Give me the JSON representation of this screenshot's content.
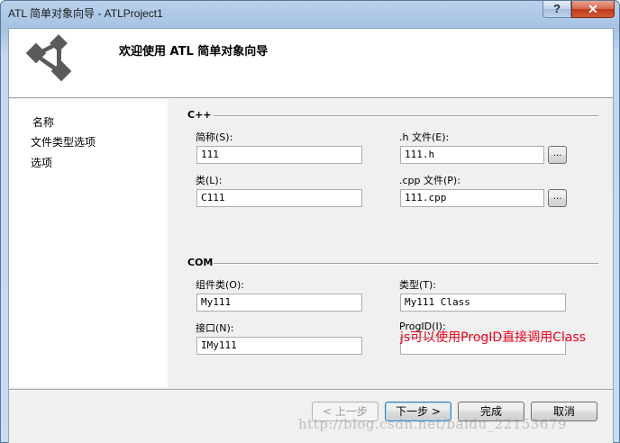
{
  "window": {
    "title": "ATL 简单对象向导 - ATLProject1",
    "help_label": "?",
    "close_label": "✕"
  },
  "header": {
    "title": "欢迎使用 ATL 简单对象向导",
    "logo_icon": "atl-wizard-logo-icon"
  },
  "sidebar": {
    "items": [
      {
        "label": "名称",
        "selected": true
      },
      {
        "label": "文件类型选项"
      },
      {
        "label": "选项"
      }
    ]
  },
  "cpp_group": {
    "title": "C++",
    "short_name": {
      "label": "简称(S):",
      "value": "111"
    },
    "h_file": {
      "label": ".h 文件(E):",
      "value": "111.h"
    },
    "class_name": {
      "label": "类(L):",
      "value": "C111"
    },
    "cpp_file": {
      "label": ".cpp 文件(P):",
      "value": "111.cpp"
    },
    "browse_label": "..."
  },
  "com_group": {
    "title": "COM",
    "coclass": {
      "label": "组件类(O):",
      "value": "My111"
    },
    "type": {
      "label": "类型(T):",
      "value": "My111 Class"
    },
    "interface": {
      "label": "接口(N):",
      "value": "IMy111"
    },
    "progid": {
      "label": "ProgID(I):",
      "value": ""
    }
  },
  "annotation": "js可以使用ProgID直接调用Class",
  "buttons": {
    "back": "< 上一步",
    "next": "下一步 >",
    "finish": "完成",
    "cancel": "取消"
  },
  "watermark": "http://blog.csdn.net/baidu_22153679",
  "colors": {
    "annotation": "#e8001c",
    "title_bar": "#b9d1ea",
    "close_button": "#c0391a"
  }
}
